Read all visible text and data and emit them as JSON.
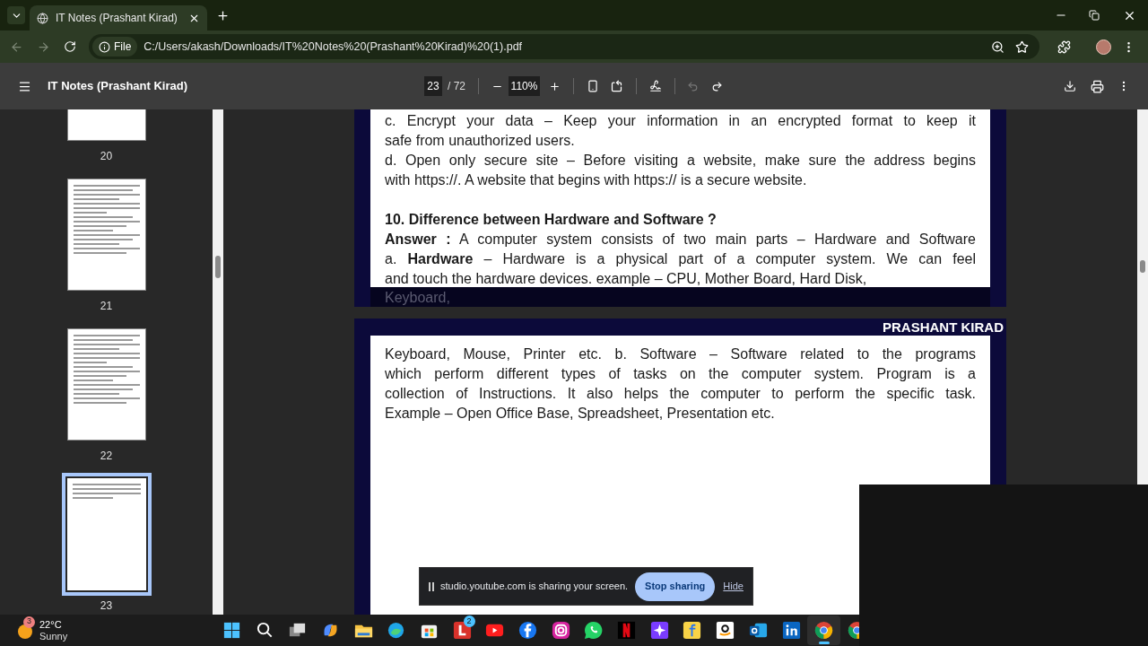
{
  "browser_tab": {
    "title": "IT Notes (Prashant Kirad)",
    "selected": true
  },
  "address_bar": {
    "scheme": "File",
    "url": "C:/Users/akash/Downloads/IT%20Notes%20(Prashant%20Kirad)%20(1).pdf"
  },
  "pdf_toolbar": {
    "title": "IT Notes (Prashant Kirad)",
    "page": "23",
    "page_total": "/ 72",
    "zoom": "110%"
  },
  "thumbnails": [
    {
      "label": "20",
      "selected": false
    },
    {
      "label": "21",
      "selected": false
    },
    {
      "label": "22",
      "selected": false
    },
    {
      "label": "23",
      "selected": true
    }
  ],
  "pages": [
    {
      "paragraphs": [
        {
          "kind": "text",
          "lines": [
            "c. Encrypt your data – Keep your information in an encrypted format to keep it",
            "safe from unauthorized users."
          ]
        },
        {
          "kind": "text",
          "lines": [
            "d. Open only secure site – Before visiting a website, make sure the address begins",
            "with https://. A website that begins with https:// is a secure website."
          ]
        },
        {
          "kind": "heading",
          "lines": [
            "10. Difference between Hardware and Software ?"
          ]
        },
        {
          "kind": "text",
          "lines": [
            "**Answer :** A computer system consists of two main parts – Hardware and Software",
            "a. **Hardware** – Hardware is a physical part of a computer system. We can feel",
            "and touch the hardware devices. example – CPU, Mother Board, Hard Disk,"
          ]
        }
      ],
      "footer_bleed": "Keyboard,"
    },
    {
      "header": "PRASHANT KIRAD",
      "paragraphs": [
        {
          "kind": "text",
          "lines": [
            "Keyboard, Mouse, Printer etc. b. Software – Software related to the programs",
            "which perform different types of tasks on the computer system. Program is a",
            "collection of Instructions. It also helps the computer to perform the specific task.",
            "Example – Open Office Base, Spreadsheet, Presentation etc."
          ]
        }
      ]
    }
  ],
  "share_bar": {
    "message": "studio.youtube.com is sharing your screen.",
    "stop": "Stop sharing",
    "hide": "Hide"
  },
  "taskbar": {
    "weather": {
      "badge": "3",
      "temperature": "22°C",
      "condition": "Sunny"
    },
    "app_badge": "2"
  }
}
